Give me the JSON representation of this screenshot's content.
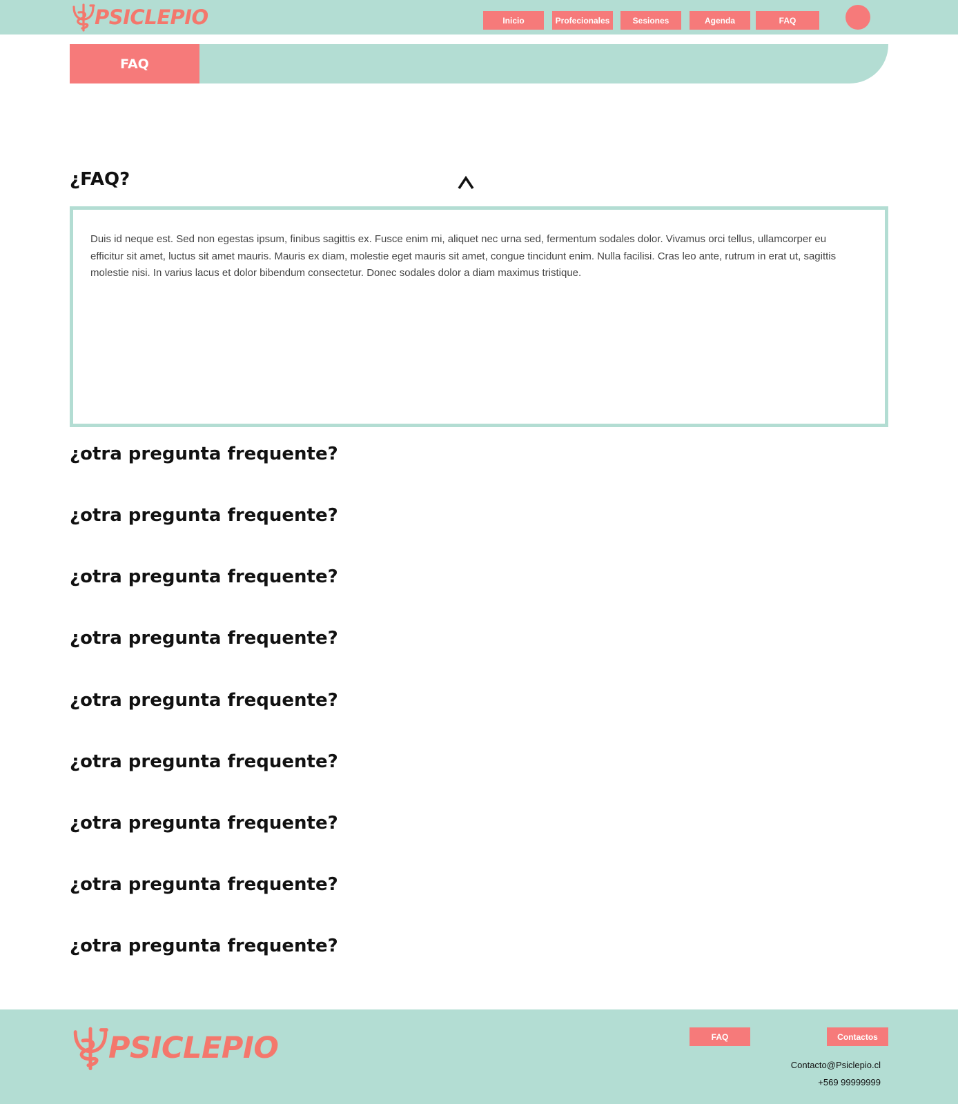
{
  "brand": {
    "name": "PSICLEPIO",
    "color": "#f4776c",
    "logo_icon": "caduceus-psi-icon"
  },
  "colors": {
    "mint": "#b3ddd3",
    "coral": "#f67a7a",
    "text": "#111111"
  },
  "nav": {
    "items": [
      {
        "label": "Inicio"
      },
      {
        "label": "Profecionales"
      },
      {
        "label": "Sesiones"
      },
      {
        "label": "Agenda"
      },
      {
        "label": "FAQ"
      }
    ],
    "avatar_icon": "user-avatar-circle"
  },
  "banner": {
    "title": "FAQ"
  },
  "faq": {
    "open_question": "¿FAQ?",
    "toggle_icon": "chevron-up-icon",
    "open_answer": "Duis id neque est. Sed non egestas ipsum, finibus sagittis ex. Fusce enim mi, aliquet nec urna sed, fermentum sodales dolor. Vivamus orci tellus, ullamcorper eu efficitur sit amet, luctus sit amet mauris. Mauris ex diam, molestie eget mauris sit amet, congue tincidunt enim. Nulla facilisi. Cras leo ante, rutrum in erat ut, sagittis molestie nisi. In varius lacus et dolor bibendum consectetur. Donec sodales dolor a diam maximus tristique.",
    "questions": [
      "¿otra pregunta frequente?",
      "¿otra pregunta frequente?",
      "¿otra pregunta frequente?",
      "¿otra pregunta frequente?",
      "¿otra pregunta frequente?",
      "¿otra pregunta frequente?",
      "¿otra pregunta frequente?",
      "¿otra pregunta frequente?",
      "¿otra pregunta frequente?"
    ]
  },
  "footer": {
    "brand": "PSICLEPIO",
    "buttons": [
      {
        "label": "FAQ"
      },
      {
        "label": "Contactos"
      }
    ],
    "email": "Contacto@Psiclepio.cl",
    "phone": "+569 99999999"
  }
}
